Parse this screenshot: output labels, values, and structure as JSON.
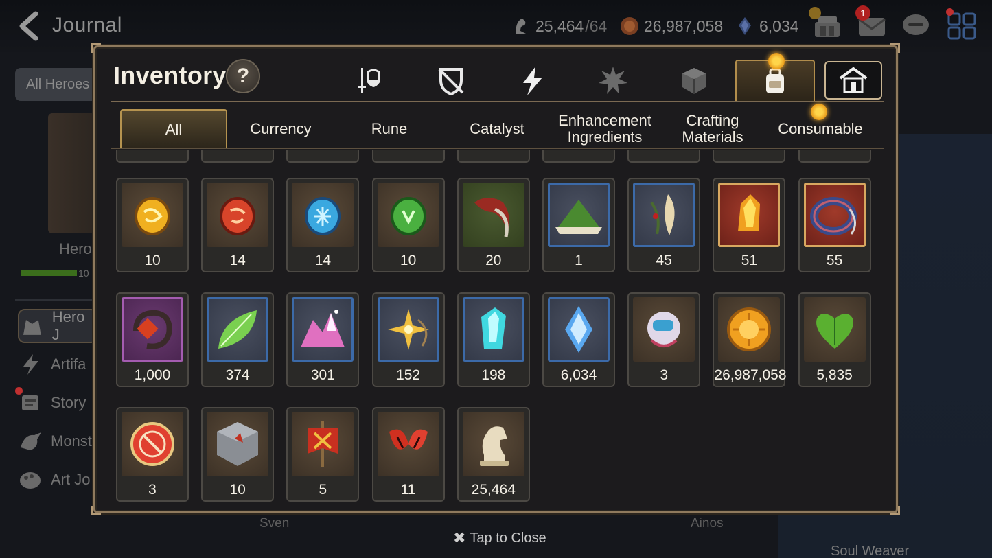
{
  "header": {
    "title": "Journal",
    "stamina": "25,464",
    "stamina_max": "/64",
    "gold": "26,987,058",
    "skystone": "6,034",
    "mail_badge": "1"
  },
  "sidebar": {
    "all_heroes": "All Heroes",
    "hero_label": "Hero",
    "hero_progress_text": "10",
    "hero_progress": 0.85,
    "items": [
      {
        "label": "Hero J",
        "icon": "hero-icon"
      },
      {
        "label": "Artifa",
        "icon": "lightning-icon"
      },
      {
        "label": "Story",
        "icon": "scroll-icon"
      },
      {
        "label": "Monst",
        "icon": "dragon-icon"
      },
      {
        "label": "Art Jo",
        "icon": "palette-icon"
      }
    ]
  },
  "background": {
    "name_left": "Sven",
    "name_right": "Ainos",
    "soul_weaver": "Soul Weaver"
  },
  "modal": {
    "title": "Inventory",
    "help": "?",
    "category_tabs": [
      {
        "icon": "weapon-armor-icon",
        "active": false
      },
      {
        "icon": "shield-broken-icon",
        "active": false
      },
      {
        "icon": "lightning-icon",
        "active": false
      },
      {
        "icon": "spiky-material-icon",
        "active": false
      },
      {
        "icon": "cube-icon",
        "active": false
      },
      {
        "icon": "backpack-icon",
        "active": true
      },
      {
        "icon": "house-icon",
        "active": false
      }
    ],
    "sub_tabs": [
      {
        "label": "All",
        "active": true
      },
      {
        "label": "Currency"
      },
      {
        "label": "Rune"
      },
      {
        "label": "Catalyst"
      },
      {
        "label": "Enhancement Ingredients"
      },
      {
        "label": "Crafting Materials"
      },
      {
        "label": "Consumable"
      }
    ],
    "close": "Tap to Close"
  },
  "items": [
    {
      "qty": "10",
      "icon": "gold-rune-icon",
      "frame": "brown",
      "color": "#f0b020"
    },
    {
      "qty": "14",
      "icon": "red-rune-icon",
      "frame": "brown",
      "color": "#d8442a"
    },
    {
      "qty": "14",
      "icon": "blue-rune-icon",
      "frame": "brown",
      "color": "#3aa8e0"
    },
    {
      "qty": "10",
      "icon": "green-rune-icon",
      "frame": "brown",
      "color": "#4ab040"
    },
    {
      "qty": "20",
      "icon": "claw-icon",
      "frame": "green",
      "color": "#9a2a22"
    },
    {
      "qty": "1",
      "icon": "green-mound-icon",
      "frame": "blue",
      "color": "#4a8a30"
    },
    {
      "qty": "45",
      "icon": "feather-branch-icon",
      "frame": "blue",
      "color": "#e8d8b0"
    },
    {
      "qty": "51",
      "icon": "fire-crystal-icon",
      "frame": "red",
      "color": "#f0a020"
    },
    {
      "qty": "55",
      "icon": "blue-ring-icon",
      "frame": "red",
      "color": "#3a4a8a"
    },
    {
      "qty": "1,000",
      "icon": "red-amulet-icon",
      "frame": "purple",
      "color": "#d84020"
    },
    {
      "qty": "374",
      "icon": "leaf-icon",
      "frame": "blue",
      "color": "#7ad050"
    },
    {
      "qty": "301",
      "icon": "pink-crystals-icon",
      "frame": "blue",
      "color": "#e070c0"
    },
    {
      "qty": "152",
      "icon": "star-pendant-icon",
      "frame": "blue",
      "color": "#f0c040"
    },
    {
      "qty": "198",
      "icon": "cyan-crystal-icon",
      "frame": "blue",
      "color": "#40d8e0"
    },
    {
      "qty": "6,034",
      "icon": "skystone-icon",
      "frame": "blue",
      "color": "#5aa8f0"
    },
    {
      "qty": "3",
      "icon": "robot-icon",
      "frame": "brown",
      "color": "#e0d8e8"
    },
    {
      "qty": "26,987,058",
      "icon": "gold-coin-icon",
      "frame": "brown",
      "color": "#f0a020"
    },
    {
      "qty": "5,835",
      "icon": "green-heart-icon",
      "frame": "brown",
      "color": "#5ab030"
    },
    {
      "qty": "3",
      "icon": "red-badge-icon",
      "frame": "brown",
      "color": "#e04030"
    },
    {
      "qty": "10",
      "icon": "stone-cube-icon",
      "frame": "brown",
      "color": "#8a8e94"
    },
    {
      "qty": "5",
      "icon": "banner-icon",
      "frame": "brown",
      "color": "#c83020"
    },
    {
      "qty": "11",
      "icon": "red-leaves-icon",
      "frame": "brown",
      "color": "#d03020"
    },
    {
      "qty": "25,464",
      "icon": "chess-knight-icon",
      "frame": "brown",
      "color": "#e8dcc0"
    }
  ]
}
